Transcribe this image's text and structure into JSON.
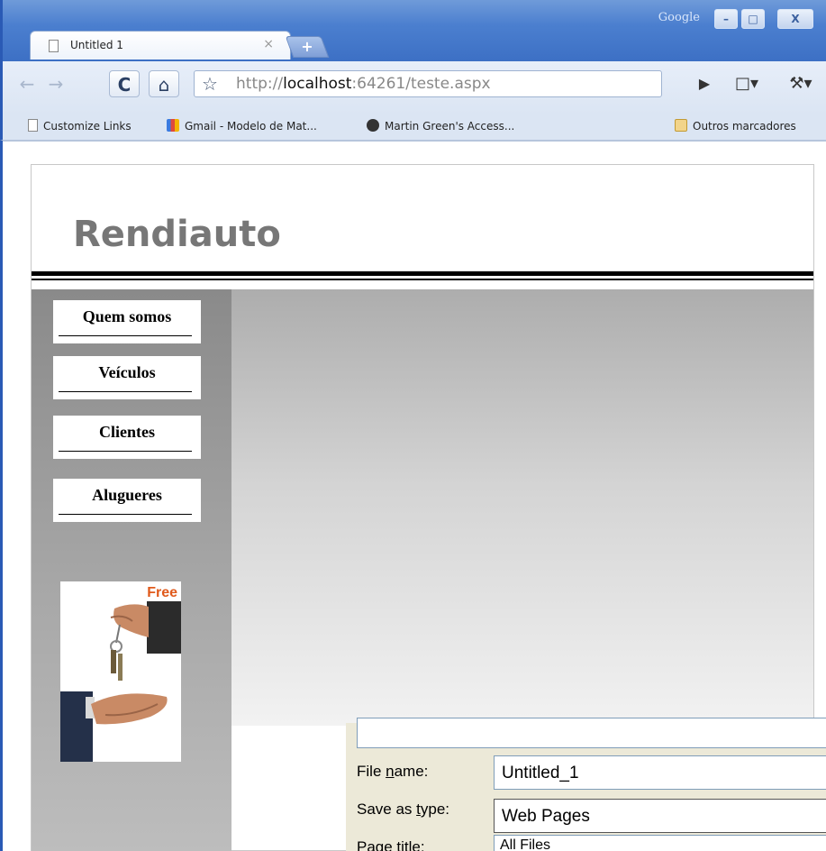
{
  "window": {
    "titlebar_brand": "Google",
    "min_glyph": "–",
    "max_glyph": "□",
    "close_glyph": "X"
  },
  "tab": {
    "title": "Untitled 1",
    "close_glyph": "×",
    "new_tab_glyph": "+"
  },
  "toolbar": {
    "back_glyph": "←",
    "forward_glyph": "→",
    "reload_glyph": "C",
    "home_glyph": "⌂",
    "star_glyph": "☆",
    "url_prefix": "http://",
    "url_host": "localhost",
    "url_rest": ":64261/teste.aspx",
    "go_glyph": "▶",
    "page_menu_glyph": "□▾",
    "wrench_glyph": "⚒▾"
  },
  "bookmarks": [
    {
      "label": "Customize Links",
      "icon": "page-icon"
    },
    {
      "label": "Gmail - Modelo de Mat...",
      "icon": "gmail-icon"
    },
    {
      "label": "Martin Green's Access...",
      "icon": "access-icon"
    },
    {
      "label": "Outros marcadores",
      "icon": "folder-icon"
    }
  ],
  "site": {
    "title": "Rendiauto",
    "nav": [
      "Quem somos",
      "Veículos",
      "Clientes",
      "Alugueres"
    ],
    "promo_text": "Free"
  },
  "dialog": {
    "file_name_label_pre": "File ",
    "file_name_label_u": "n",
    "file_name_label_post": "ame:",
    "file_name_value": "Untitled_1",
    "type_label_pre": "Save as ",
    "type_label_u": "t",
    "type_label_post": "ype:",
    "type_value": "Web Pages",
    "page_title_label": "Page title:",
    "dropdown_option": "All Files"
  }
}
